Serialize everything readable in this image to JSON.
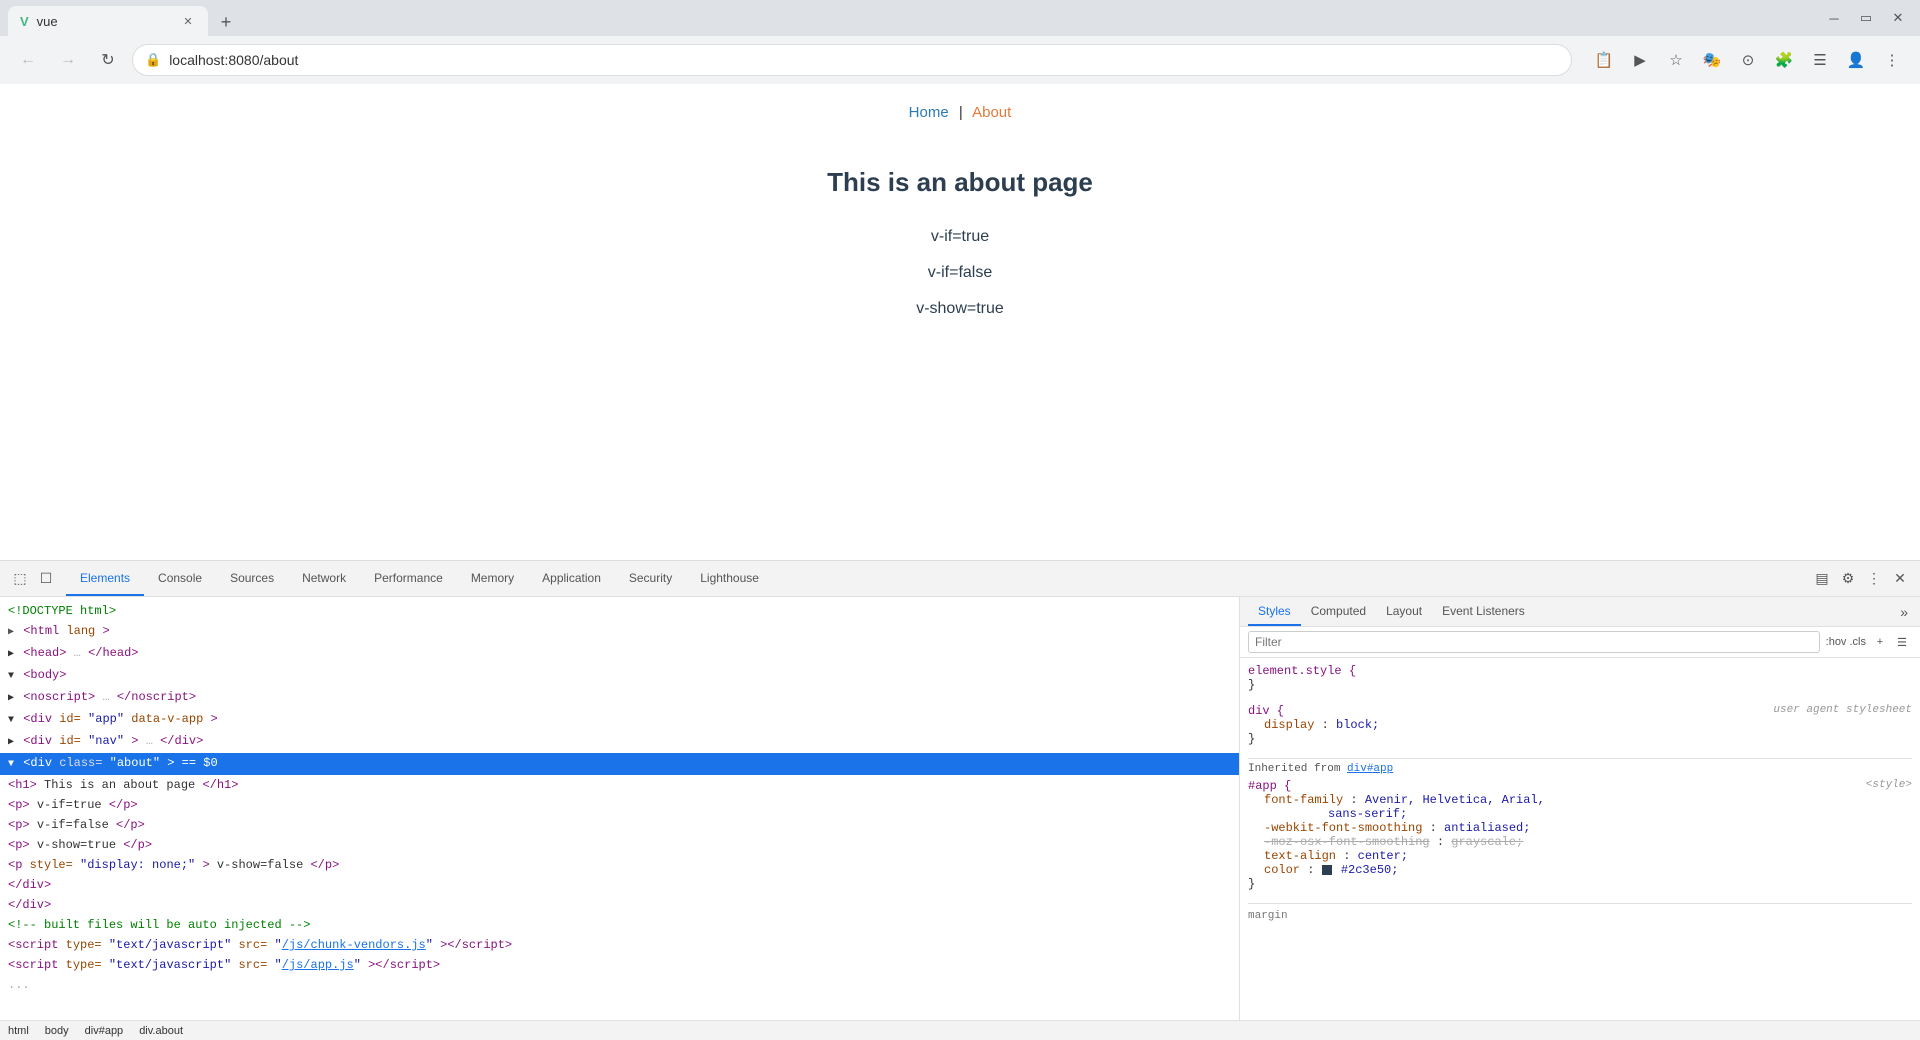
{
  "browser": {
    "tab_title": "vue",
    "tab_url": "localhost:8080/about",
    "new_tab_label": "+",
    "vue_logo": "V"
  },
  "address_bar": {
    "url": "localhost:8080/about",
    "lock_icon": "🔒"
  },
  "toolbar_icons": [
    "📋",
    "▶",
    "☆",
    "🎭",
    "⊙",
    "🧩",
    "☰",
    "👤",
    "⋮"
  ],
  "page": {
    "nav": {
      "home": "Home",
      "separator": "|",
      "about": "About"
    },
    "heading": "This is an about page",
    "lines": [
      "v-if=true",
      "v-if=false",
      "v-show=true"
    ]
  },
  "devtools": {
    "tabs": [
      "Elements",
      "Console",
      "Sources",
      "Network",
      "Performance",
      "Memory",
      "Application",
      "Security",
      "Lighthouse"
    ],
    "active_tab": "Elements",
    "styles_tabs": [
      "Styles",
      "Computed",
      "Layout",
      "Event Listeners"
    ],
    "active_styles_tab": "Styles",
    "filter_placeholder": "Filter",
    "filter_pseudo": ":hov .cls",
    "elements": [
      {
        "indent": 0,
        "text": "<!DOCTYPE html>",
        "type": "comment"
      },
      {
        "indent": 0,
        "text": "<html lang>",
        "type": "tag"
      },
      {
        "indent": 1,
        "text": "▶<head>…</head>",
        "collapsed": true
      },
      {
        "indent": 1,
        "text": "▼<body>",
        "open": true
      },
      {
        "indent": 2,
        "text": "▶<noscript>…</noscript>",
        "collapsed": true
      },
      {
        "indent": 2,
        "text": "▼<div id=\"app\" data-v-app>",
        "open": true
      },
      {
        "indent": 3,
        "text": "▶<div id=\"nav\">…</div>",
        "collapsed": true
      },
      {
        "indent": 3,
        "text": "▼<div class=\"about\"> == $0",
        "open": true,
        "selected": true
      },
      {
        "indent": 4,
        "text": "<h1>This is an about page</h1>"
      },
      {
        "indent": 4,
        "text": "<p>v-if=true</p>"
      },
      {
        "indent": 4,
        "text": "<p>v-if=false</p>"
      },
      {
        "indent": 4,
        "text": "<p>v-show=true</p>"
      },
      {
        "indent": 4,
        "text": "<p style=\"display: none;\">v-show=false</p>"
      },
      {
        "indent": 3,
        "text": "</div>"
      },
      {
        "indent": 2,
        "text": "</div>"
      },
      {
        "indent": 2,
        "text": "<!-- built files will be auto injected -->"
      },
      {
        "indent": 2,
        "text": "<script type=\"text/javascript\" src=\"/js/chunk-vendors.js\"><\\/script>"
      },
      {
        "indent": 2,
        "text": "<script type=\"text/javascript\" src=\"/js/app.js\"><\\/script>"
      }
    ],
    "styles": {
      "element_style": {
        "selector": "element.style {",
        "close": "}"
      },
      "div_rule": {
        "selector": "div {",
        "source": "user agent stylesheet",
        "props": [
          {
            "name": "display",
            "value": "block"
          }
        ],
        "close": "}"
      },
      "inherited_from": "Inherited from div#app",
      "app_rule": {
        "selector": "#app {",
        "source": "<style>",
        "props": [
          {
            "name": "font-family",
            "value": "Avenir, Helvetica, Arial, sans-serif"
          },
          {
            "name": "-webkit-font-smoothing",
            "value": "antialiased;"
          },
          {
            "name": "-moz-osx-font-smoothing",
            "value": "grayscale;"
          },
          {
            "name": "text-align",
            "value": "center;"
          },
          {
            "name": "color",
            "value": "#2c3e50;"
          }
        ],
        "close": "}"
      }
    },
    "statusbar": {
      "breadcrumbs": [
        "html",
        "body",
        "div#app",
        "div.about"
      ]
    }
  }
}
